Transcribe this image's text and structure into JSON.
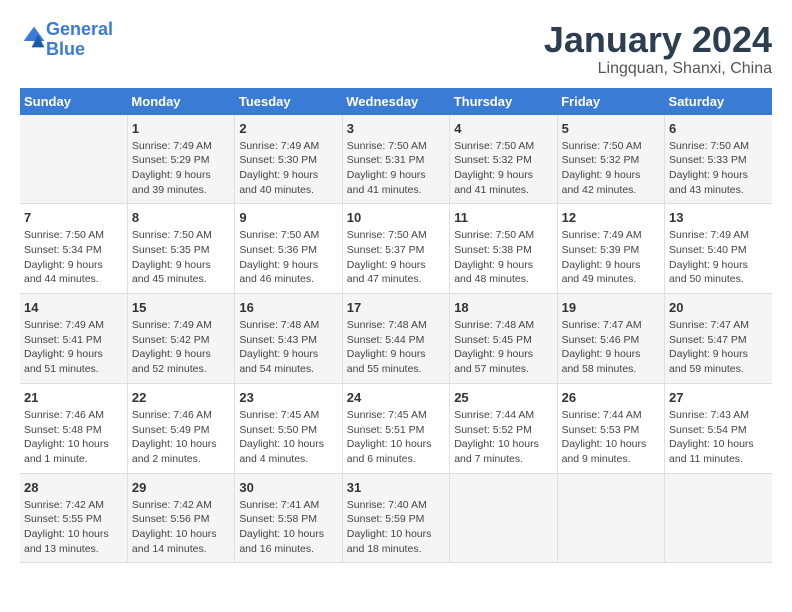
{
  "header": {
    "logo_line1": "General",
    "logo_line2": "Blue",
    "title": "January 2024",
    "location": "Lingquan, Shanxi, China"
  },
  "calendar": {
    "days_of_week": [
      "Sunday",
      "Monday",
      "Tuesday",
      "Wednesday",
      "Thursday",
      "Friday",
      "Saturday"
    ],
    "weeks": [
      [
        {
          "day": "",
          "info": ""
        },
        {
          "day": "1",
          "info": "Sunrise: 7:49 AM\nSunset: 5:29 PM\nDaylight: 9 hours\nand 39 minutes."
        },
        {
          "day": "2",
          "info": "Sunrise: 7:49 AM\nSunset: 5:30 PM\nDaylight: 9 hours\nand 40 minutes."
        },
        {
          "day": "3",
          "info": "Sunrise: 7:50 AM\nSunset: 5:31 PM\nDaylight: 9 hours\nand 41 minutes."
        },
        {
          "day": "4",
          "info": "Sunrise: 7:50 AM\nSunset: 5:32 PM\nDaylight: 9 hours\nand 41 minutes."
        },
        {
          "day": "5",
          "info": "Sunrise: 7:50 AM\nSunset: 5:32 PM\nDaylight: 9 hours\nand 42 minutes."
        },
        {
          "day": "6",
          "info": "Sunrise: 7:50 AM\nSunset: 5:33 PM\nDaylight: 9 hours\nand 43 minutes."
        }
      ],
      [
        {
          "day": "7",
          "info": "Sunrise: 7:50 AM\nSunset: 5:34 PM\nDaylight: 9 hours\nand 44 minutes."
        },
        {
          "day": "8",
          "info": "Sunrise: 7:50 AM\nSunset: 5:35 PM\nDaylight: 9 hours\nand 45 minutes."
        },
        {
          "day": "9",
          "info": "Sunrise: 7:50 AM\nSunset: 5:36 PM\nDaylight: 9 hours\nand 46 minutes."
        },
        {
          "day": "10",
          "info": "Sunrise: 7:50 AM\nSunset: 5:37 PM\nDaylight: 9 hours\nand 47 minutes."
        },
        {
          "day": "11",
          "info": "Sunrise: 7:50 AM\nSunset: 5:38 PM\nDaylight: 9 hours\nand 48 minutes."
        },
        {
          "day": "12",
          "info": "Sunrise: 7:49 AM\nSunset: 5:39 PM\nDaylight: 9 hours\nand 49 minutes."
        },
        {
          "day": "13",
          "info": "Sunrise: 7:49 AM\nSunset: 5:40 PM\nDaylight: 9 hours\nand 50 minutes."
        }
      ],
      [
        {
          "day": "14",
          "info": "Sunrise: 7:49 AM\nSunset: 5:41 PM\nDaylight: 9 hours\nand 51 minutes."
        },
        {
          "day": "15",
          "info": "Sunrise: 7:49 AM\nSunset: 5:42 PM\nDaylight: 9 hours\nand 52 minutes."
        },
        {
          "day": "16",
          "info": "Sunrise: 7:48 AM\nSunset: 5:43 PM\nDaylight: 9 hours\nand 54 minutes."
        },
        {
          "day": "17",
          "info": "Sunrise: 7:48 AM\nSunset: 5:44 PM\nDaylight: 9 hours\nand 55 minutes."
        },
        {
          "day": "18",
          "info": "Sunrise: 7:48 AM\nSunset: 5:45 PM\nDaylight: 9 hours\nand 57 minutes."
        },
        {
          "day": "19",
          "info": "Sunrise: 7:47 AM\nSunset: 5:46 PM\nDaylight: 9 hours\nand 58 minutes."
        },
        {
          "day": "20",
          "info": "Sunrise: 7:47 AM\nSunset: 5:47 PM\nDaylight: 9 hours\nand 59 minutes."
        }
      ],
      [
        {
          "day": "21",
          "info": "Sunrise: 7:46 AM\nSunset: 5:48 PM\nDaylight: 10 hours\nand 1 minute."
        },
        {
          "day": "22",
          "info": "Sunrise: 7:46 AM\nSunset: 5:49 PM\nDaylight: 10 hours\nand 2 minutes."
        },
        {
          "day": "23",
          "info": "Sunrise: 7:45 AM\nSunset: 5:50 PM\nDaylight: 10 hours\nand 4 minutes."
        },
        {
          "day": "24",
          "info": "Sunrise: 7:45 AM\nSunset: 5:51 PM\nDaylight: 10 hours\nand 6 minutes."
        },
        {
          "day": "25",
          "info": "Sunrise: 7:44 AM\nSunset: 5:52 PM\nDaylight: 10 hours\nand 7 minutes."
        },
        {
          "day": "26",
          "info": "Sunrise: 7:44 AM\nSunset: 5:53 PM\nDaylight: 10 hours\nand 9 minutes."
        },
        {
          "day": "27",
          "info": "Sunrise: 7:43 AM\nSunset: 5:54 PM\nDaylight: 10 hours\nand 11 minutes."
        }
      ],
      [
        {
          "day": "28",
          "info": "Sunrise: 7:42 AM\nSunset: 5:55 PM\nDaylight: 10 hours\nand 13 minutes."
        },
        {
          "day": "29",
          "info": "Sunrise: 7:42 AM\nSunset: 5:56 PM\nDaylight: 10 hours\nand 14 minutes."
        },
        {
          "day": "30",
          "info": "Sunrise: 7:41 AM\nSunset: 5:58 PM\nDaylight: 10 hours\nand 16 minutes."
        },
        {
          "day": "31",
          "info": "Sunrise: 7:40 AM\nSunset: 5:59 PM\nDaylight: 10 hours\nand 18 minutes."
        },
        {
          "day": "",
          "info": ""
        },
        {
          "day": "",
          "info": ""
        },
        {
          "day": "",
          "info": ""
        }
      ]
    ]
  }
}
